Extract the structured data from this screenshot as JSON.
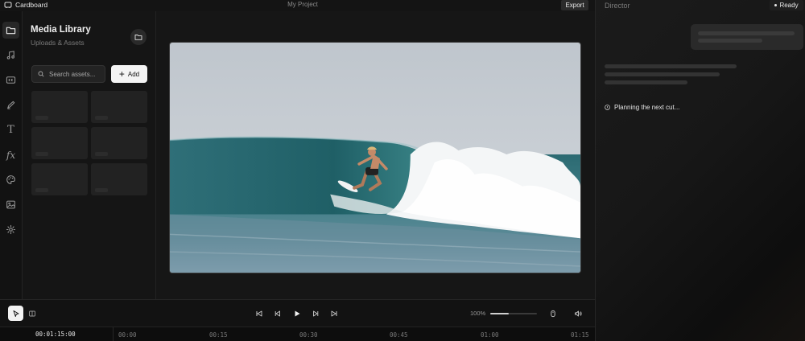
{
  "app": {
    "brand": "Cardboard",
    "project_title": "My Project",
    "export_label": "Export"
  },
  "director": {
    "title": "Director",
    "status": "Ready",
    "planning_text": "Planning the next cut..."
  },
  "media": {
    "title": "Media Library",
    "subtitle": "Uploads & Assets",
    "search_placeholder": "Search assets...",
    "add_label": "Add"
  },
  "playback": {
    "zoom": "100%",
    "zoom_level": 0.4
  },
  "timeline": {
    "timecode": "00:01:15:00",
    "ticks": [
      "00:00",
      "00:15",
      "00:30",
      "00:45",
      "01:00",
      "01:15"
    ]
  },
  "rail_icons": [
    "folder-icon",
    "music-icon",
    "captions-icon",
    "pen-icon",
    "text-icon",
    "fx-icon",
    "palette-icon",
    "image-icon",
    "settings-icon"
  ]
}
